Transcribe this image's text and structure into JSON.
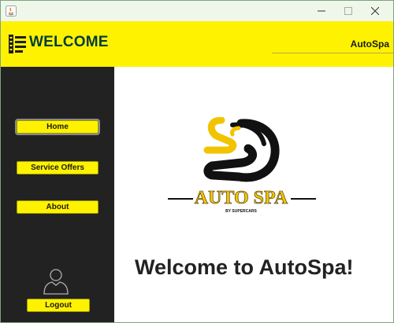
{
  "window": {
    "controls": [
      "minimize",
      "maximize",
      "close"
    ]
  },
  "header": {
    "title": "WELCOME",
    "brand": "AutoSpa",
    "background": "#fff200",
    "title_color": "#003c3c"
  },
  "sidebar": {
    "background": "#222222",
    "items": [
      {
        "label": "Home",
        "active": true
      },
      {
        "label": "Service Offers",
        "active": false
      },
      {
        "label": "About",
        "active": false
      }
    ],
    "logout_label": "Logout"
  },
  "main": {
    "logo": {
      "text": "AUTO SPA",
      "tagline": "BY SUPERCARS",
      "gold": "#f2c400"
    },
    "welcome_text": "Welcome to AutoSpa!"
  }
}
